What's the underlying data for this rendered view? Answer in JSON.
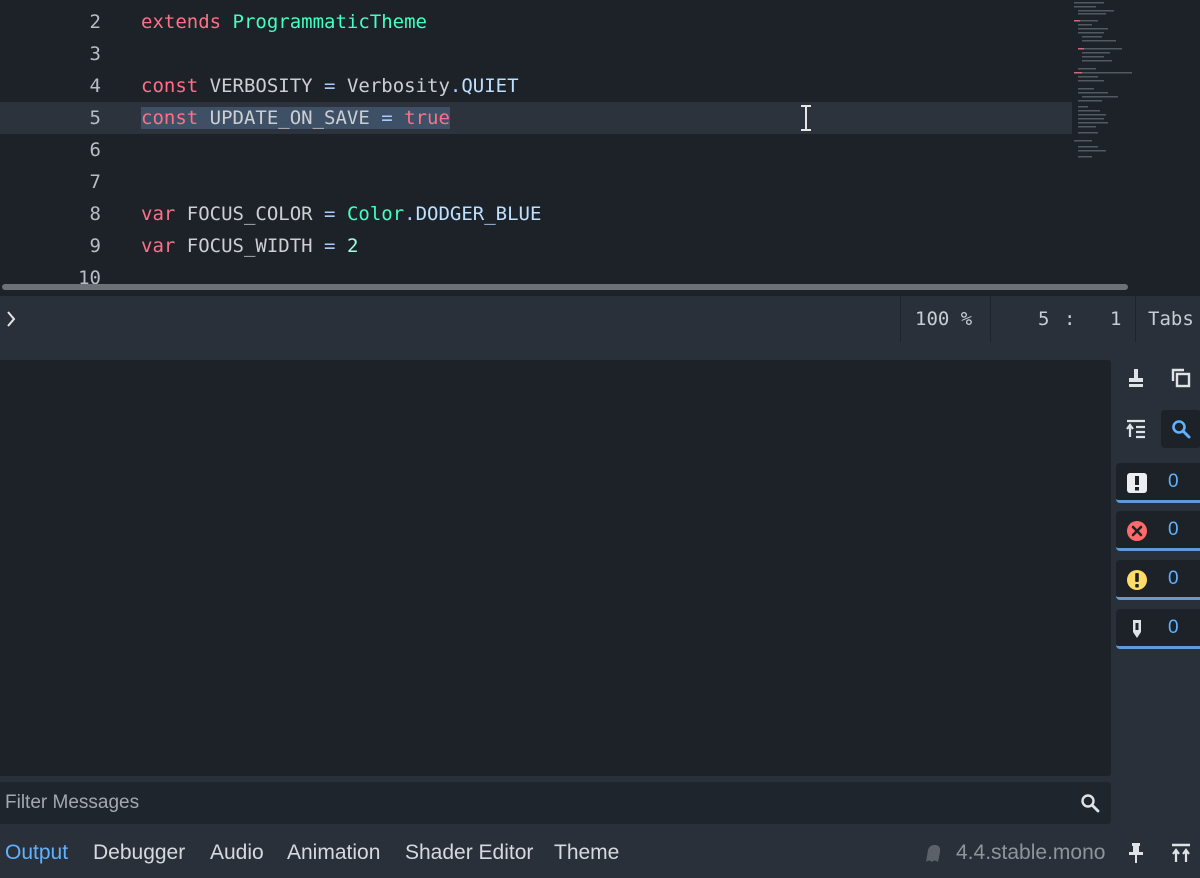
{
  "editor": {
    "lines": [
      {
        "num": "2",
        "tokens": [
          {
            "t": "extends",
            "c": "kw"
          },
          {
            "t": " ",
            "c": "ident"
          },
          {
            "t": "ProgrammaticTheme",
            "c": "cls"
          }
        ]
      },
      {
        "num": "3",
        "tokens": []
      },
      {
        "num": "4",
        "tokens": [
          {
            "t": "const",
            "c": "kw"
          },
          {
            "t": " VERBOSITY ",
            "c": "ident"
          },
          {
            "t": "=",
            "c": "op"
          },
          {
            "t": " Verbosity",
            "c": "ident"
          },
          {
            "t": ".",
            "c": "op"
          },
          {
            "t": "QUIET",
            "c": "const"
          }
        ]
      },
      {
        "num": "5",
        "current": true,
        "tokens": [
          {
            "t": "const",
            "c": "kw",
            "sel": true
          },
          {
            "t": " UPDATE_ON_SAVE ",
            "c": "ident",
            "sel": true
          },
          {
            "t": "=",
            "c": "op",
            "sel": true
          },
          {
            "t": " ",
            "c": "ident",
            "sel": true
          },
          {
            "t": "true",
            "c": "kw",
            "sel": true
          }
        ]
      },
      {
        "num": "6",
        "tokens": []
      },
      {
        "num": "7",
        "tokens": []
      },
      {
        "num": "8",
        "tokens": [
          {
            "t": "var",
            "c": "kw"
          },
          {
            "t": " FOCUS_COLOR ",
            "c": "ident"
          },
          {
            "t": "=",
            "c": "op"
          },
          {
            "t": " ",
            "c": "ident"
          },
          {
            "t": "Color",
            "c": "cls"
          },
          {
            "t": ".",
            "c": "op"
          },
          {
            "t": "DODGER_BLUE",
            "c": "const"
          }
        ]
      },
      {
        "num": "9",
        "tokens": [
          {
            "t": "var",
            "c": "kw"
          },
          {
            "t": " FOCUS_WIDTH ",
            "c": "ident"
          },
          {
            "t": "=",
            "c": "op"
          },
          {
            "t": " ",
            "c": "ident"
          },
          {
            "t": "2",
            "c": "num"
          }
        ]
      },
      {
        "num": "10",
        "tokens": []
      }
    ]
  },
  "statusbar": {
    "zoom": "100 %",
    "line": "5",
    "colon": ":",
    "column": "1",
    "indent": "Tabs"
  },
  "output": {
    "filter_placeholder": "Filter Messages",
    "counts": {
      "messages": "0",
      "errors": "0",
      "warnings": "0",
      "editor_messages": "0"
    }
  },
  "bottom_tabs": [
    {
      "label": "Output",
      "active": true
    },
    {
      "label": "Debugger"
    },
    {
      "label": "Audio"
    },
    {
      "label": "Animation"
    },
    {
      "label": "Shader Editor"
    },
    {
      "label": "Theme"
    }
  ],
  "version": "4.4.stable.mono",
  "colors": {
    "accent": "#5fb2ff",
    "error": "#ff5d5d",
    "warning": "#ffdd65",
    "keyword": "#ff7085",
    "class": "#42ffc2"
  },
  "icons": {
    "clear": "broom-icon",
    "copy": "copy-icon",
    "collapse": "collapse-icon",
    "search": "search-icon",
    "message": "message-icon",
    "error": "error-icon",
    "warning": "warning-icon",
    "editor_message": "editor-message-icon",
    "pin": "pin-icon",
    "expand": "expand-panel-icon"
  }
}
